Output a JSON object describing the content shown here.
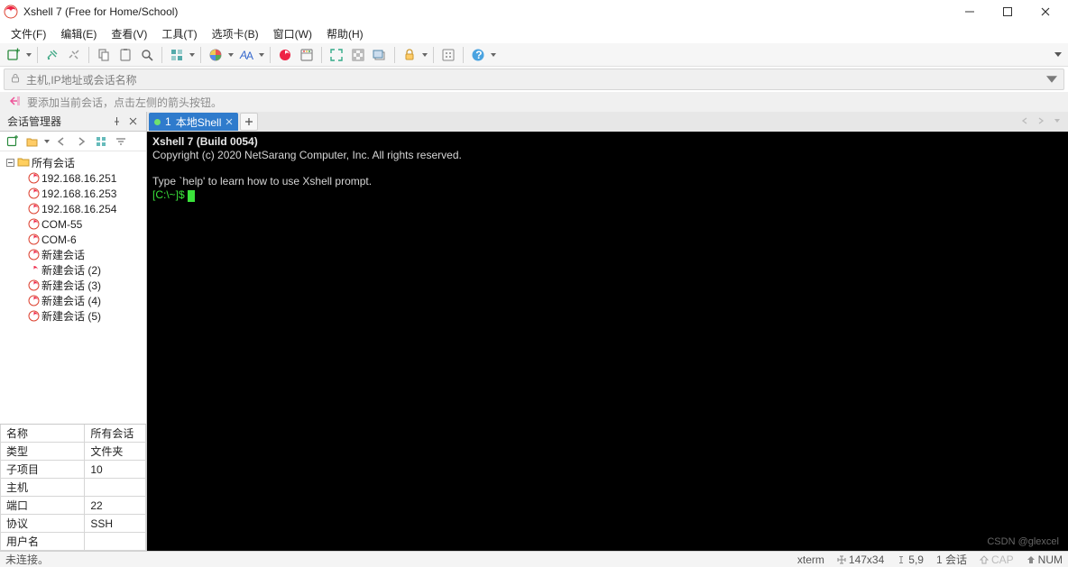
{
  "window": {
    "title": "Xshell 7 (Free for Home/School)"
  },
  "menu": {
    "items": [
      "文件(F)",
      "编辑(E)",
      "查看(V)",
      "工具(T)",
      "选项卡(B)",
      "窗口(W)",
      "帮助(H)"
    ]
  },
  "addressbar": {
    "placeholder": "主机,IP地址或会话名称"
  },
  "tipbar": {
    "text": "要添加当前会话，点击左侧的箭头按钮。"
  },
  "sessions_panel": {
    "title": "会话管理器",
    "root": "所有会话",
    "items": [
      "192.168.16.251",
      "192.168.16.253",
      "192.168.16.254",
      "COM-55",
      "COM-6",
      "新建会话",
      "新建会话 (2)",
      "新建会话 (3)",
      "新建会话 (4)",
      "新建会话 (5)"
    ],
    "props": [
      {
        "k": "名称",
        "v": "所有会话"
      },
      {
        "k": "类型",
        "v": "文件夹"
      },
      {
        "k": "子项目",
        "v": "10"
      },
      {
        "k": "主机",
        "v": ""
      },
      {
        "k": "端口",
        "v": "22"
      },
      {
        "k": "协议",
        "v": "SSH"
      },
      {
        "k": "用户名",
        "v": ""
      }
    ]
  },
  "tabs": {
    "active": {
      "index": "1",
      "label": "本地Shell"
    }
  },
  "terminal": {
    "line1": "Xshell 7 (Build 0054)",
    "line2": "Copyright (c) 2020 NetSarang Computer, Inc. All rights reserved.",
    "line3": "",
    "line4": "Type `help' to learn how to use Xshell prompt.",
    "prompt": "[C:\\~]$ "
  },
  "statusbar": {
    "left": "未连接。",
    "term": "xterm",
    "size": "147x34",
    "cursor": "5,9",
    "sess_count": "1 会话",
    "caps": "CAP",
    "num": "NUM"
  },
  "watermark": "CSDN @glexcel"
}
